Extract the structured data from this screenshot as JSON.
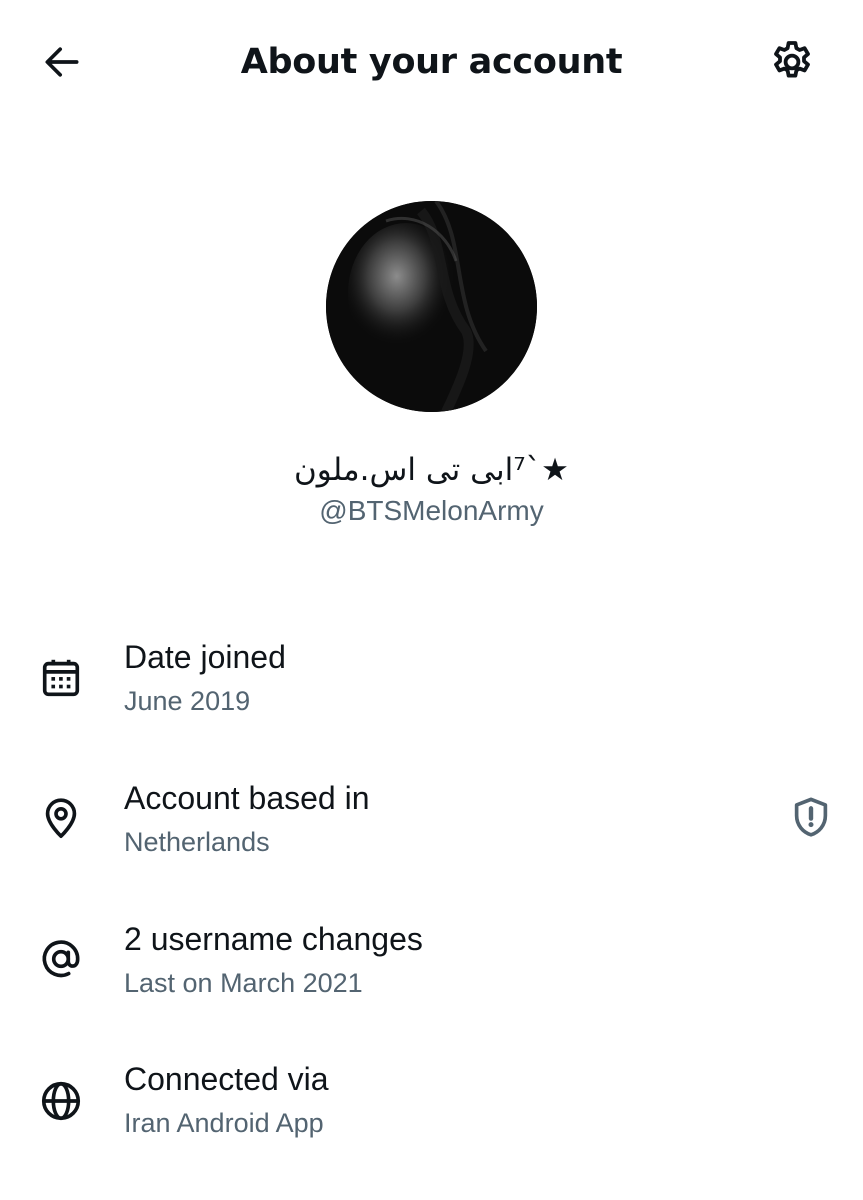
{
  "header": {
    "title": "About your account",
    "back_icon": "arrow-left-icon",
    "settings_icon": "gear-icon"
  },
  "profile": {
    "display_name": "★`⁷ابی تی اس.ملون",
    "handle": "@BTSMelonArmy"
  },
  "details": [
    {
      "icon": "calendar-icon",
      "title": "Date joined",
      "value": "June 2019"
    },
    {
      "icon": "location-pin-icon",
      "title": "Account based in",
      "value": "Netherlands",
      "trailing_icon": "shield-alert-icon"
    },
    {
      "icon": "at-sign-icon",
      "title": "2 username changes",
      "value": "Last on March 2021"
    },
    {
      "icon": "globe-icon",
      "title": "Connected via",
      "value": "Iran Android App"
    }
  ],
  "colors": {
    "primary_text": "#0f1419",
    "secondary_text": "#536471",
    "background": "#ffffff"
  }
}
